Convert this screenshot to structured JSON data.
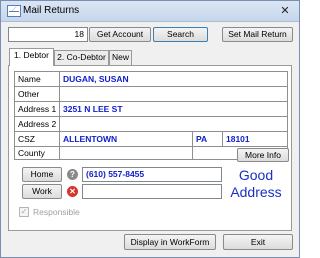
{
  "window": {
    "title": "Mail Returns",
    "close_glyph": "✕"
  },
  "toolbar": {
    "count_value": "18",
    "get_account_label": "Get Account",
    "search_label": "Search",
    "set_mail_return_label": "Set Mail Return"
  },
  "tabs": [
    {
      "label": "1. Debtor",
      "active": true
    },
    {
      "label": "2. Co-Debtor",
      "active": false
    },
    {
      "label": "New",
      "active": false
    }
  ],
  "debtor": {
    "labels": {
      "name": "Name",
      "other": "Other",
      "address1": "Address 1",
      "address2": "Address 2",
      "csz": "CSZ",
      "county": "County"
    },
    "name": "DUGAN, SUSAN",
    "other": "",
    "address1": "3251 N LEE ST",
    "address2": "",
    "city": "ALLENTOWN",
    "state": "PA",
    "zip": "18101",
    "county": "",
    "more_info_label": "More Info"
  },
  "phones": {
    "home_label": "Home",
    "home_number": "(610) 557-8455",
    "home_status_icon": "question-circle-icon",
    "work_label": "Work",
    "work_number": "",
    "work_status_icon": "x-circle-icon"
  },
  "address_status": {
    "line1": "Good",
    "line2": "Address",
    "color": "#1a2fc8"
  },
  "responsible": {
    "label": "Responsible",
    "checked": true,
    "enabled": false
  },
  "footer": {
    "display_label": "Display in WorkForm",
    "exit_label": "Exit"
  }
}
